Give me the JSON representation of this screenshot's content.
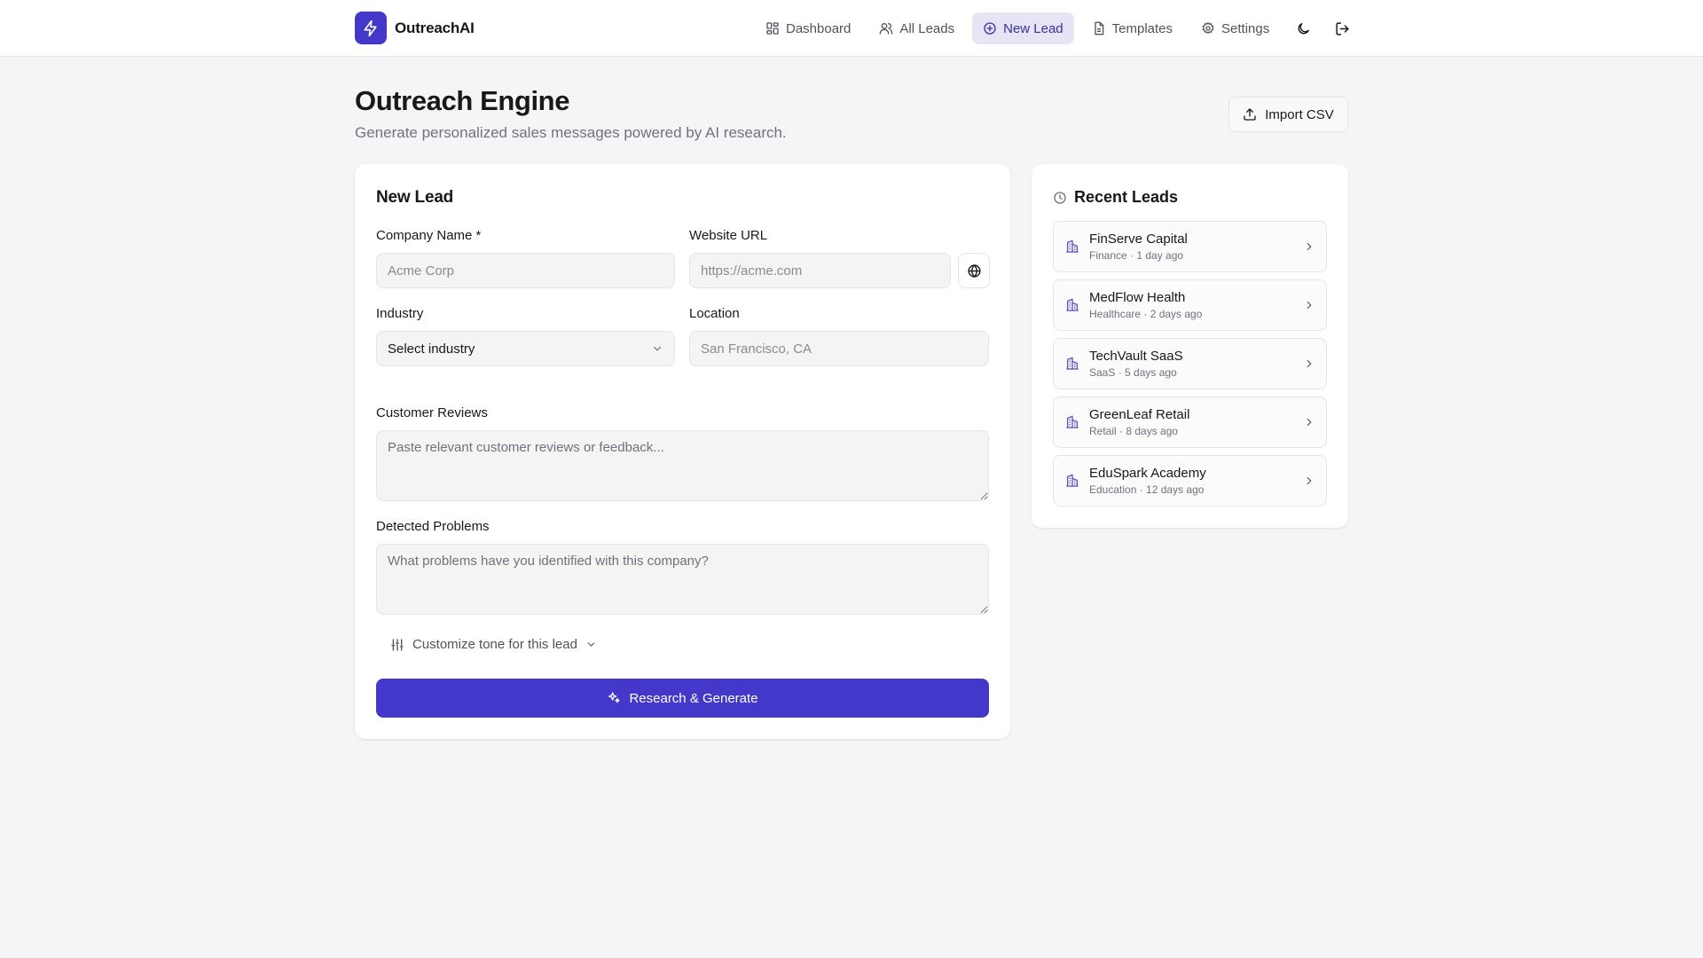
{
  "brand": {
    "name": "OutreachAI"
  },
  "nav": {
    "items": [
      {
        "label": "Dashboard",
        "icon": "dashboard-icon"
      },
      {
        "label": "All Leads",
        "icon": "users-icon"
      },
      {
        "label": "New Lead",
        "icon": "plus-circle-icon",
        "active": true
      },
      {
        "label": "Templates",
        "icon": "document-icon"
      },
      {
        "label": "Settings",
        "icon": "gear-icon"
      }
    ],
    "theme_icon": "moon-icon",
    "logout_icon": "logout-icon"
  },
  "header": {
    "title": "Outreach Engine",
    "subtitle": "Generate personalized sales messages powered by AI research.",
    "import_label": "Import CSV"
  },
  "form": {
    "title": "New Lead",
    "company": {
      "label": "Company Name *",
      "placeholder": "Acme Corp",
      "value": ""
    },
    "website": {
      "label": "Website URL",
      "placeholder": "https://acme.com",
      "value": ""
    },
    "industry": {
      "label": "Industry",
      "selected": "Select industry"
    },
    "location": {
      "label": "Location",
      "placeholder": "San Francisco, CA",
      "value": ""
    },
    "reviews": {
      "label": "Customer Reviews",
      "placeholder": "Paste relevant customer reviews or feedback..."
    },
    "problems": {
      "label": "Detected Problems",
      "placeholder": "What problems have you identified with this company?"
    },
    "tone_label": "Customize tone for this lead",
    "submit_label": "Research & Generate"
  },
  "recent": {
    "title": "Recent Leads",
    "items": [
      {
        "name": "FinServe Capital",
        "meta": "Finance · 1 day ago"
      },
      {
        "name": "MedFlow Health",
        "meta": "Healthcare · 2 days ago"
      },
      {
        "name": "TechVault SaaS",
        "meta": "SaaS · 5 days ago"
      },
      {
        "name": "GreenLeaf Retail",
        "meta": "Retail · 8 days ago"
      },
      {
        "name": "EduSpark Academy",
        "meta": "Education · 12 days ago"
      }
    ]
  },
  "colors": {
    "accent": "#4338ca",
    "accent_soft": "#e6e4f5",
    "page_bg": "#f5f5f7",
    "border": "#e4e4e7"
  }
}
